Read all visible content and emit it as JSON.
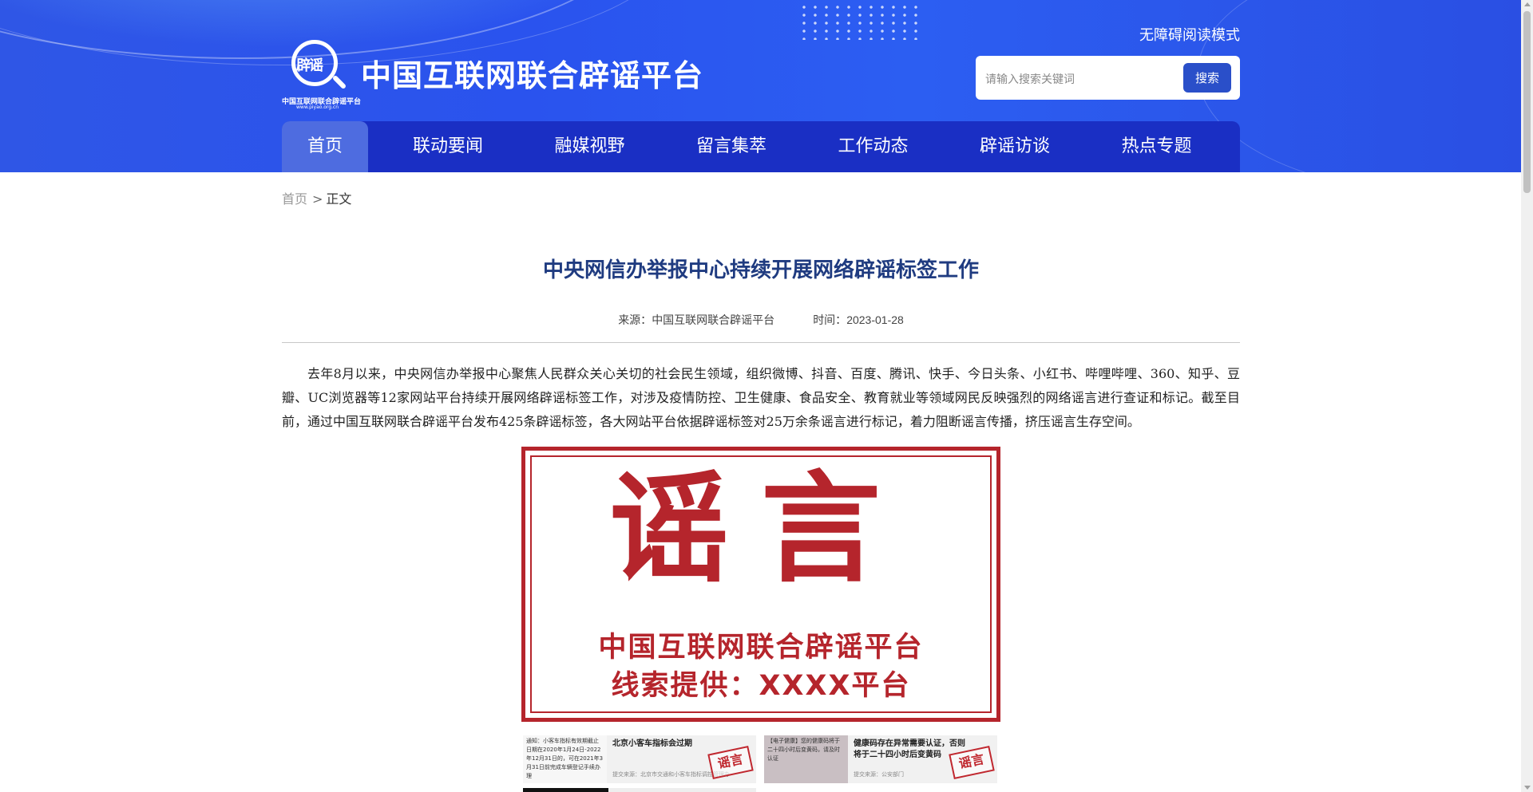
{
  "header": {
    "site_title": "中国互联网联合辟谣平台",
    "logo_mark": "辟谣",
    "logo_sub": "中国互联网联合辟谣平台",
    "logo_url": "www.piyao.org.cn",
    "accessibility_label": "无障碍阅读模式",
    "search": {
      "placeholder": "请输入搜索关键词",
      "button_label": "搜索"
    }
  },
  "nav": {
    "items": [
      {
        "label": "首页",
        "active": true
      },
      {
        "label": "联动要闻"
      },
      {
        "label": "融媒视野"
      },
      {
        "label": "留言集萃"
      },
      {
        "label": "工作动态"
      },
      {
        "label": "辟谣访谈"
      },
      {
        "label": "热点专题"
      }
    ]
  },
  "breadcrumb": {
    "home": "首页",
    "separator": ">",
    "current": "正文"
  },
  "article": {
    "title": "中央网信办举报中心持续开展网络辟谣标签工作",
    "source_label": "来源：",
    "source": "中国互联网联合辟谣平台",
    "time_label": "时间：",
    "date": "2023-01-28",
    "paragraph": "去年8月以来，中央网信办举报中心聚焦人民群众关心关切的社会民生领域，组织微博、抖音、百度、腾讯、快手、今日头条、小红书、哔哩哔哩、360、知乎、豆瓣、UC浏览器等12家网站平台持续开展网络辟谣标签工作，对涉及疫情防控、卫生健康、食品安全、教育就业等领域网民反映强烈的网络谣言进行查证和标记。截至目前，通过中国互联网联合辟谣平台发布425条辟谣标签，各大网站平台依据辟谣标签对25万余条谣言进行标记，着力阻断谣言传播，挤压谣言生存空间。"
  },
  "poster": {
    "big_text": "谣言",
    "line1": "中国互联网联合辟谣平台",
    "line2": "线索提供：XXXX平台"
  },
  "thumbs": [
    {
      "left_text": "通知：小客车指标有效期截止日期在2020年1月24日-2022年12月31日的，可在2021年3月31日前完成车辆登记手续办理",
      "title": "北京小客车指标会过期",
      "source": "提交来源：北京市交通和小客车指标调控管理办",
      "stamp": "谣言"
    },
    {
      "left_text": "【电子健康】您的健康码将于二十四小时后变黄码，请及时认证",
      "title": "健康码存在异常需要认证，否则将于二十四小时后变黄码",
      "source": "提交来源：公安部门",
      "stamp": "谣言"
    }
  ],
  "colors": {
    "header_blue": "#2a53ee",
    "nav_blue": "#1a2fc4",
    "nav_active": "#4e6ce0",
    "title_blue": "#1f3b80",
    "poster_red": "#b5252c"
  }
}
